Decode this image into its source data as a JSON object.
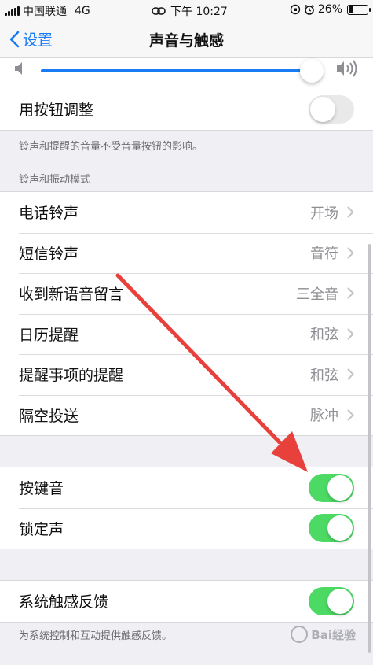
{
  "status_bar": {
    "carrier": "中国联通",
    "network": "4G",
    "time": "下午 10:27",
    "battery_percent": "26%",
    "battery_level": 0.26
  },
  "nav": {
    "back_label": "设置",
    "title": "声音与触感"
  },
  "volume_slider": {
    "value": 0.97
  },
  "button_adjust": {
    "label": "用按钮调整",
    "enabled": false,
    "footnote": "铃声和提醒的音量不受音量按钮的影响。"
  },
  "ringtone_section": {
    "header": "铃声和振动模式",
    "items": [
      {
        "label": "电话铃声",
        "value": "开场"
      },
      {
        "label": "短信铃声",
        "value": "音符"
      },
      {
        "label": "收到新语音留言",
        "value": "三全音"
      },
      {
        "label": "日历提醒",
        "value": "和弦"
      },
      {
        "label": "提醒事项的提醒",
        "value": "和弦"
      },
      {
        "label": "隔空投送",
        "value": "脉冲"
      }
    ]
  },
  "sound_toggles": [
    {
      "label": "按键音",
      "enabled": true
    },
    {
      "label": "锁定声",
      "enabled": true
    }
  ],
  "haptics": {
    "label": "系统触感反馈",
    "enabled": true,
    "footnote": "为系统控制和互动提供触感反馈。"
  },
  "colors": {
    "accent": "#1a7cf5",
    "toggle_on": "#4cd964",
    "arrow": "#e8413c"
  },
  "watermark": {
    "text": "Bai经验"
  }
}
